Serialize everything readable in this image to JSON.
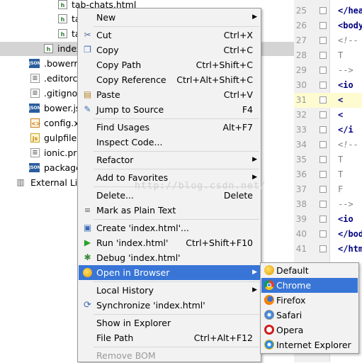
{
  "tree": {
    "items": [
      {
        "label": "tab-chats.html",
        "icon": "html-file-icon"
      },
      {
        "label": "ta",
        "icon": "html-file-icon"
      },
      {
        "label": "ta",
        "icon": "html-file-icon"
      },
      {
        "label": "index",
        "icon": "html-file-icon"
      },
      {
        "label": ".bowerrc",
        "icon": "json-file-icon"
      },
      {
        "label": ".editorcc",
        "icon": "text-file-icon"
      },
      {
        "label": ".gitignor",
        "icon": "text-file-icon"
      },
      {
        "label": "bower.js",
        "icon": "json-file-icon"
      },
      {
        "label": "config.xr",
        "icon": "xml-file-icon"
      },
      {
        "label": "gulpfile.j",
        "icon": "js-file-icon"
      },
      {
        "label": "ionic.pro",
        "icon": "text-file-icon"
      },
      {
        "label": "package",
        "icon": "json-file-icon"
      },
      {
        "label": "External Libr",
        "icon": "library-icon"
      }
    ]
  },
  "editor": {
    "lines": [
      {
        "num": "25",
        "code": "</hea"
      },
      {
        "num": "26",
        "code": "<body"
      },
      {
        "num": "27",
        "code": "<!--"
      },
      {
        "num": "28",
        "code": "T"
      },
      {
        "num": "29",
        "code": "-->"
      },
      {
        "num": "30",
        "code": "<io"
      },
      {
        "num": "31",
        "code": "<"
      },
      {
        "num": "32",
        "code": "<"
      },
      {
        "num": "33",
        "code": "</i"
      },
      {
        "num": "34",
        "code": "<!--"
      },
      {
        "num": "35",
        "code": "T"
      },
      {
        "num": "36",
        "code": "T"
      },
      {
        "num": "37",
        "code": "F"
      },
      {
        "num": "38",
        "code": "-->"
      },
      {
        "num": "39",
        "code": "<io"
      },
      {
        "num": "40",
        "code": "</bod"
      },
      {
        "num": "41",
        "code": "</html"
      }
    ]
  },
  "menu": {
    "new": "New",
    "cut": "Cut",
    "cut_short": "Ctrl+X",
    "copy": "Copy",
    "copy_short": "Ctrl+C",
    "copy_path": "Copy Path",
    "copy_path_short": "Ctrl+Shift+C",
    "copy_reference": "Copy Reference",
    "copy_reference_short": "Ctrl+Alt+Shift+C",
    "paste": "Paste",
    "paste_short": "Ctrl+V",
    "jump_to_source": "Jump to Source",
    "jump_to_source_short": "F4",
    "find_usages": "Find Usages",
    "find_usages_short": "Alt+F7",
    "inspect_code": "Inspect Code...",
    "refactor": "Refactor",
    "add_to_favorites": "Add to Favorites",
    "delete": "Delete...",
    "delete_short": "Delete",
    "mark_as_plain_text": "Mark as Plain Text",
    "create": "Create 'index.html'...",
    "run": "Run 'index.html'",
    "run_short": "Ctrl+Shift+F10",
    "debug": "Debug 'index.html'",
    "open_in_browser": "Open in Browser",
    "local_history": "Local History",
    "synchronize": "Synchronize 'index.html'",
    "show_in_explorer": "Show in Explorer",
    "file_path": "File Path",
    "file_path_short": "Ctrl+Alt+F12",
    "remove_bom": "Remove BOM"
  },
  "browsers": {
    "default": "Default",
    "chrome": "Chrome",
    "firefox": "Firefox",
    "safari": "Safari",
    "opera": "Opera",
    "ie": "Internet Explorer"
  },
  "watermark": "http://blog.csdn.net/",
  "colors": {
    "highlight": "#3875d7",
    "menu_bg": "#f2f2f2",
    "selected_row": "#d4d4d4",
    "current_line": "#fffbd1"
  }
}
